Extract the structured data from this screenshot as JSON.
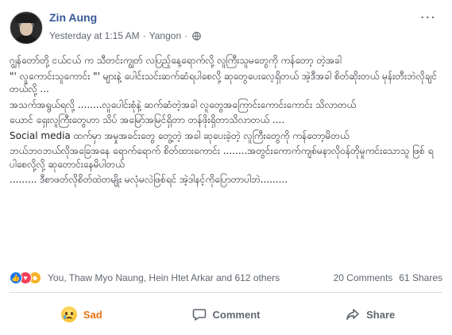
{
  "post": {
    "author": "Zin Aung",
    "timestamp": "Yesterday at 1:15 AM",
    "separator": "·",
    "location": "Yangon",
    "more_label": "···",
    "paragraphs": [
      "ဂျွန်တော်တို့ ငယ်ငယ် က သီတင်းကျွတ် လပြည့်နေ့ရောက်လို့ လူကြီးသူမတွေကို ကန်တော့ တဲ့အခါ",
      "\"' လူကောင်းသူကောင်း \"' များနဲ့ ပေါင်းသင်းဆက်ဆံရပါစေလို့ ဆုတွေပေးလေ့ရှိတယ် အဲ့ဒီအခါ စိတ်ဆိုးတယ် မုန်းတီးဘဲလိုချင်တယ်လို့ ...",
      "အသက်အရွယ်ရလို့ ........လူပေါင်းစုံနဲ့ ဆက်ဆံတဲ့အခါ လူတွေအကြောင်းကောင်းကောင်း သိလာတယ်",
      "ယောင် ရှေးလူကြီးတွေဟာ သိပ် အမြော်အမြင်ရှိတာ တန်ဖိုးရှိတာသိလာတယ် ....",
      "Social media ထက်မှာ အမှုအခင်းတွေ တွေ့တဲ့ အခါ ဆုပေးခဲ့တဲ့ လူကြီးတွေကို ကန်တော့မိတယ်",
      "ဘယ်ဘဝဘယ်လိုအခြေအနေ ရောက်ရောက် စိတ်ထားကောင်း ........အတွင်းကောက်ကျစ်မနာလိုဝန်တိုမှုကင်းသောသူ ဖြစ် ရပါစေလို့လို့ ဆုတောင်းနေမိပါတယ်",
      "......... ဒီစာဖတ်လိုစိတ်ထဲတမျိုး မလုံမလဲဖြစ်ရင် အဲ့ဒါနင့်ကိုပြောတာပါဘဲ........."
    ]
  },
  "reactions": {
    "icons": [
      "like-icon",
      "love-icon",
      "haha-icon"
    ],
    "summary": "You, Thaw Myo Naung, Hein Htet Arkar and 612 others",
    "comments": "20 Comments",
    "shares": "61 Shares"
  },
  "actions": {
    "sad_label": "Sad",
    "comment_label": "Comment",
    "share_label": "Share"
  },
  "colors": {
    "author": "#385898",
    "sad": "#e9710f",
    "like": "#1877f2",
    "love": "#f33e58",
    "haha": "#f7b125"
  }
}
